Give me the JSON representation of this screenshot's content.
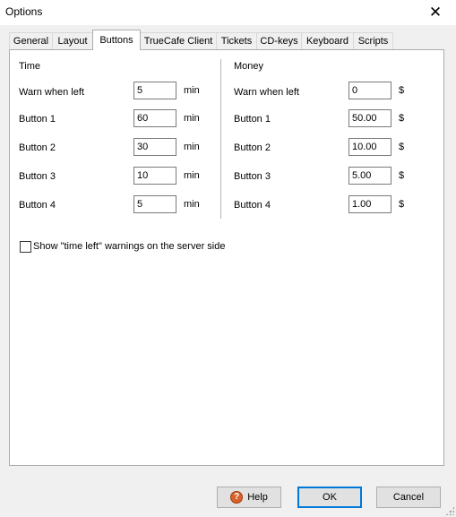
{
  "window": {
    "title": "Options",
    "close_glyph": "✕"
  },
  "tabs": [
    {
      "label": "General"
    },
    {
      "label": "Layout"
    },
    {
      "label": "Buttons",
      "active": true
    },
    {
      "label": "TrueCafe Client"
    },
    {
      "label": "Tickets"
    },
    {
      "label": "CD-keys"
    },
    {
      "label": "Keyboard"
    },
    {
      "label": "Scripts"
    }
  ],
  "time": {
    "header": "Time",
    "unit": "min",
    "rows": [
      {
        "label": "Warn when left",
        "value": "5"
      },
      {
        "label": "Button 1",
        "value": "60"
      },
      {
        "label": "Button 2",
        "value": "30"
      },
      {
        "label": "Button 3",
        "value": "10"
      },
      {
        "label": "Button 4",
        "value": "5"
      }
    ]
  },
  "money": {
    "header": "Money",
    "unit": "$",
    "rows": [
      {
        "label": "Warn when left",
        "value": "0"
      },
      {
        "label": "Button 1",
        "value": "50.00"
      },
      {
        "label": "Button 2",
        "value": "10.00"
      },
      {
        "label": "Button 3",
        "value": "5.00"
      },
      {
        "label": "Button 4",
        "value": "1.00"
      }
    ]
  },
  "server_warning": {
    "label": "Show \"time left\" warnings on the server side",
    "checked": false
  },
  "footer": {
    "help_label": "Help",
    "ok_label": "OK",
    "cancel_label": "Cancel"
  },
  "icons": {
    "help": "help-icon",
    "close": "close-icon"
  }
}
